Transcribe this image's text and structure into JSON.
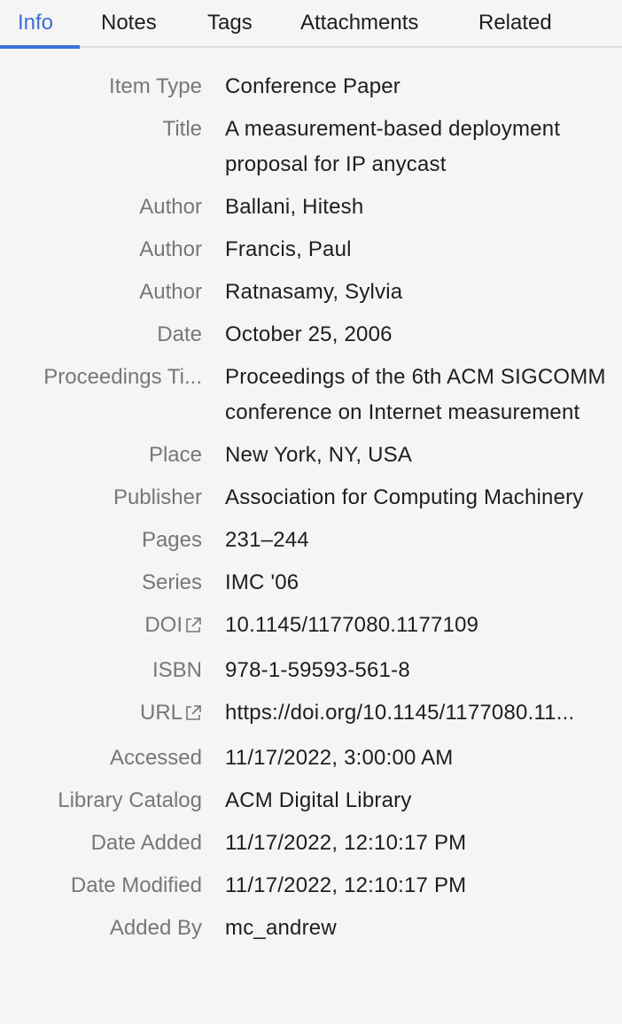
{
  "tabs": [
    {
      "label": "Info"
    },
    {
      "label": "Notes"
    },
    {
      "label": "Tags"
    },
    {
      "label": "Attachments"
    },
    {
      "label": "Related"
    }
  ],
  "fields": [
    {
      "label": "Item Type",
      "value": "Conference Paper"
    },
    {
      "label": "Title",
      "value": "A measurement-based deployment proposal for IP anycast"
    },
    {
      "label": "Author",
      "value": "Ballani, Hitesh"
    },
    {
      "label": "Author",
      "value": "Francis, Paul"
    },
    {
      "label": "Author",
      "value": "Ratnasamy, Sylvia"
    },
    {
      "label": "Date",
      "value": "October 25, 2006"
    },
    {
      "label": "Proceedings Ti...",
      "value": "Proceedings of the 6th ACM SIGCOMM conference on Internet measurement"
    },
    {
      "label": "Place",
      "value": "New York, NY, USA"
    },
    {
      "label": "Publisher",
      "value": "Association for Computing Machinery"
    },
    {
      "label": "Pages",
      "value": "231–244"
    },
    {
      "label": "Series",
      "value": "IMC '06"
    },
    {
      "label": "DOI",
      "value": "10.1145/1177080.1177109"
    },
    {
      "label": "ISBN",
      "value": "978-1-59593-561-8"
    },
    {
      "label": "URL",
      "value": "https://doi.org/10.1145/1177080.11..."
    },
    {
      "label": "Accessed",
      "value": "11/17/2022, 3:00:00 AM"
    },
    {
      "label": "Library Catalog",
      "value": "ACM Digital Library"
    },
    {
      "label": "Date Added",
      "value": "11/17/2022, 12:10:17 PM"
    },
    {
      "label": "Date Modified",
      "value": "11/17/2022, 12:10:17 PM"
    },
    {
      "label": "Added By",
      "value": "mc_andrew"
    }
  ],
  "colors": {
    "accent": "#3b6fd6",
    "label": "#777777",
    "text": "#1e1e1e",
    "background": "#f5f5f5"
  },
  "icons": {
    "external_link": "external-link-icon"
  }
}
